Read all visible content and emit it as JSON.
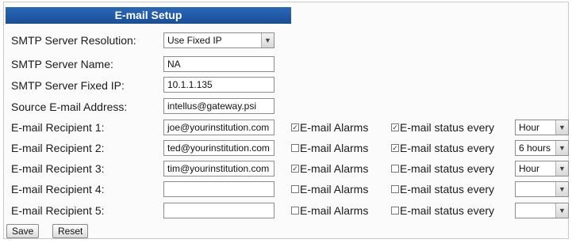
{
  "title": "E-mail Setup",
  "fields": {
    "resolution": {
      "label": "SMTP Server Resolution:",
      "value": "Use Fixed IP"
    },
    "server_name": {
      "label": "SMTP Server Name:",
      "value": "NA"
    },
    "fixed_ip": {
      "label": "SMTP Server Fixed IP:",
      "value": "10.1.1.135"
    },
    "source_email": {
      "label": "Source E-mail Address:",
      "value": "intellus@gateway.psi"
    }
  },
  "alarms_label": "E-mail Alarms",
  "status_label": "E-mail status every",
  "recipients": [
    {
      "label": "E-mail Recipient 1:",
      "email": "joe@yourinstitution.com",
      "alarms": true,
      "status": true,
      "interval": "Hour"
    },
    {
      "label": "E-mail Recipient 2:",
      "email": "ted@yourinstitution.com",
      "alarms": false,
      "status": true,
      "interval": "6 hours"
    },
    {
      "label": "E-mail Recipient 3:",
      "email": "tim@yourinstitution.com",
      "alarms": true,
      "status": false,
      "interval": "Hour"
    },
    {
      "label": "E-mail Recipient 4:",
      "email": "",
      "alarms": false,
      "status": false,
      "interval": ""
    },
    {
      "label": "E-mail Recipient 5:",
      "email": "",
      "alarms": false,
      "status": false,
      "interval": ""
    }
  ],
  "buttons": {
    "save": "Save",
    "reset": "Reset"
  }
}
